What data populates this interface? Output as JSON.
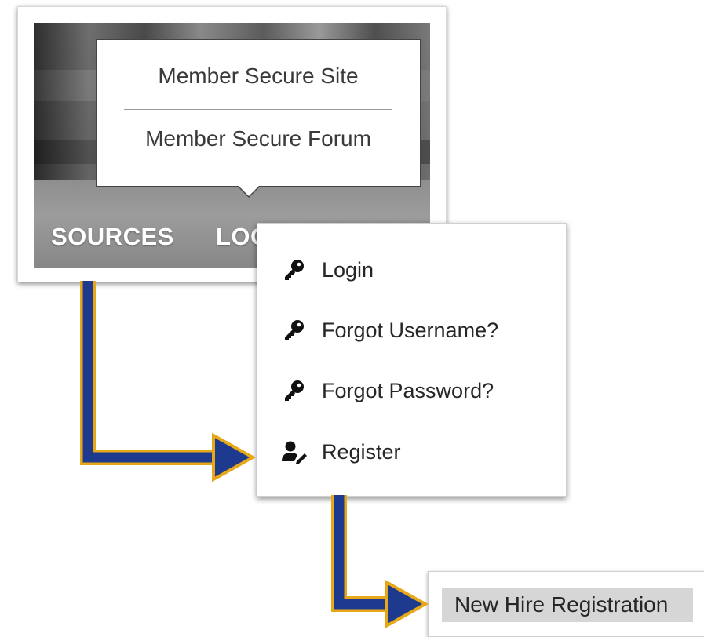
{
  "nav": {
    "resources_label": "SOURCES",
    "login_label": "LOGI"
  },
  "member_menu": {
    "items": [
      {
        "label": "Member Secure Site"
      },
      {
        "label": "Member Secure Forum"
      }
    ]
  },
  "login_dropdown": {
    "items": [
      {
        "label": "Login",
        "icon": "key-icon"
      },
      {
        "label": "Forgot Username?",
        "icon": "key-icon"
      },
      {
        "label": "Forgot Password?",
        "icon": "key-icon"
      },
      {
        "label": "Register",
        "icon": "user-edit-icon"
      }
    ]
  },
  "new_hire": {
    "label": "New Hire Registration"
  },
  "colors": {
    "arrow_fill": "#1d3a8f",
    "arrow_outline": "#e6a817"
  }
}
